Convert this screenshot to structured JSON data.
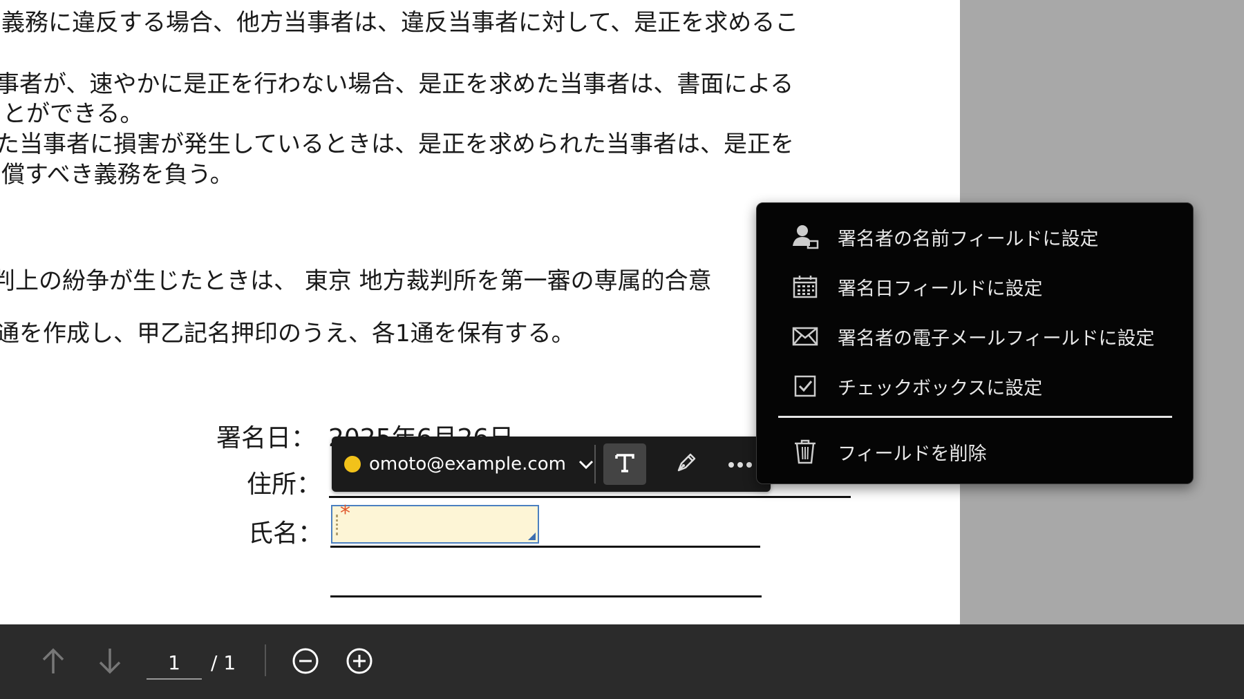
{
  "document": {
    "lines": [
      "義務に違反する場合、他方当事者は、違反当事者に対して、是正を求めるこ",
      "事者が、速やかに是正を行わない場合、是正を求めた当事者は、書面による",
      "とができる。",
      "た当事者に損害が発生しているときは、是正を求められた当事者は、是正を",
      "償すべき義務を負う。",
      "判上の紛争が生じたときは、 東京 地方裁判所を第一審の専属的合意",
      "通を作成し、甲乙記名押印のうえ、各1通を保有する。"
    ],
    "sign_date_label": "署名日：",
    "sign_date_value": "2025年6月26日",
    "address_label": "住所：",
    "name_label": "氏名：",
    "required_marker": "*"
  },
  "field_toolbar": {
    "signer_email": "omoto@example.com",
    "signer_color": "#f2c21a",
    "text_tool_icon": "text-T-icon",
    "signature_tool_icon": "pen-icon",
    "more_icon": "more-dots-icon"
  },
  "context_menu": {
    "items": [
      {
        "label": "署名者の名前フィールドに設定",
        "icon": "person-icon"
      },
      {
        "label": "署名日フィールドに設定",
        "icon": "calendar-icon"
      },
      {
        "label": "署名者の電子メールフィールドに設定",
        "icon": "envelope-icon"
      },
      {
        "label": "チェックボックスに設定",
        "icon": "checkbox-icon"
      }
    ],
    "delete_label": "フィールドを削除",
    "delete_icon": "trash-icon"
  },
  "bottom_bar": {
    "current_page": "1",
    "total_pages": "/ 1",
    "icons": [
      "arrow-up-icon",
      "arrow-down-icon",
      "zoom-out-icon",
      "zoom-in-icon"
    ]
  }
}
